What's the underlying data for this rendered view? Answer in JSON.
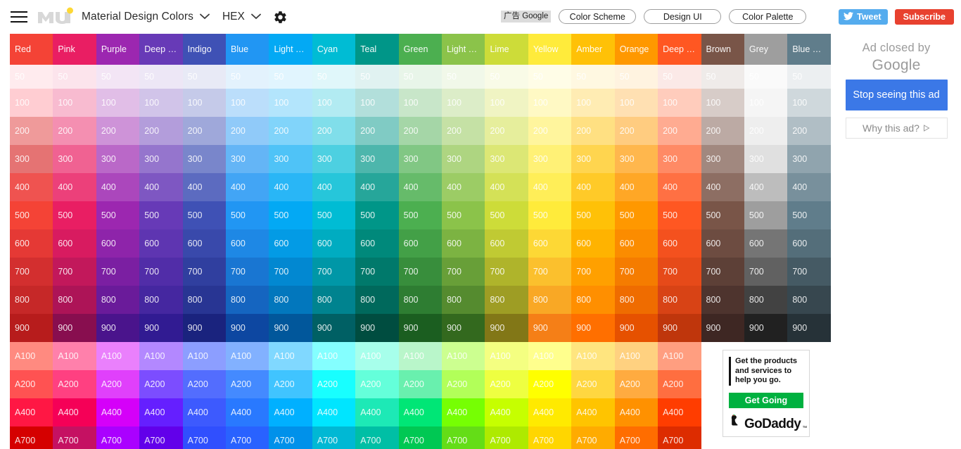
{
  "appbar": {
    "menu_icon": "hamburger-menu-icon",
    "logo": "mui-logo",
    "palette_title": "Material Design Colors",
    "palette_chevron": "chevron-down-icon",
    "format_label": "HEX",
    "format_chevron": "chevron-down-icon",
    "settings_icon": "gear-icon",
    "ad_tag": "广告 Google",
    "ad_chips": [
      "Color Scheme",
      "Design UI",
      "Color Palette"
    ],
    "tweet_label": "Tweet",
    "tweet_icon": "twitter-bird-icon",
    "tweet_color": "#55acee",
    "subscribe_label": "Subscribe",
    "subscribe_color": "#e8412f"
  },
  "ad_panel": {
    "closed_line1": "Ad closed by",
    "closed_line2": "Google",
    "stop_button": "Stop seeing this ad",
    "stop_button_color": "#3b78e7",
    "why_button": "Why this ad?",
    "why_icon": "play-triangle-icon"
  },
  "godaddy_ad": {
    "headline": "Get the products and services to help you go.",
    "cta_label": "Get Going",
    "cta_color": "#00b140",
    "brand": "GoDaddy",
    "brand_mark": "™",
    "logo_icon": "godaddy-heart-icon"
  },
  "palette": {
    "shade_labels": [
      "50",
      "100",
      "200",
      "300",
      "400",
      "500",
      "600",
      "700",
      "800",
      "900",
      "A100",
      "A200",
      "A400",
      "A700"
    ],
    "columns": [
      {
        "name": "Red",
        "label": "Red",
        "shades": {
          "50": "#ffebee",
          "100": "#ffcdd2",
          "200": "#ef9a9a",
          "300": "#e57373",
          "400": "#ef5350",
          "500": "#f44336",
          "600": "#e53935",
          "700": "#d32f2f",
          "800": "#c62828",
          "900": "#b71c1c",
          "A100": "#ff8a80",
          "A200": "#ff5252",
          "A400": "#ff1744",
          "A700": "#d50000"
        }
      },
      {
        "name": "Pink",
        "label": "Pink",
        "shades": {
          "50": "#fce4ec",
          "100": "#f8bbd0",
          "200": "#f48fb1",
          "300": "#f06292",
          "400": "#ec407a",
          "500": "#e91e63",
          "600": "#d81b60",
          "700": "#c2185b",
          "800": "#ad1457",
          "900": "#880e4f",
          "A100": "#ff80ab",
          "A200": "#ff4081",
          "A400": "#f50057",
          "A700": "#c51162"
        }
      },
      {
        "name": "Purple",
        "label": "Purple",
        "shades": {
          "50": "#f3e5f5",
          "100": "#e1bee7",
          "200": "#ce93d8",
          "300": "#ba68c8",
          "400": "#ab47bc",
          "500": "#9c27b0",
          "600": "#8e24aa",
          "700": "#7b1fa2",
          "800": "#6a1b9a",
          "900": "#4a148c",
          "A100": "#ea80fc",
          "A200": "#e040fb",
          "A400": "#d500f9",
          "A700": "#aa00ff"
        }
      },
      {
        "name": "Deep Purple",
        "label": "Deep …",
        "shades": {
          "50": "#ede7f6",
          "100": "#d1c4e9",
          "200": "#b39ddb",
          "300": "#9575cd",
          "400": "#7e57c2",
          "500": "#673ab7",
          "600": "#5e35b1",
          "700": "#512da8",
          "800": "#4527a0",
          "900": "#311b92",
          "A100": "#b388ff",
          "A200": "#7c4dff",
          "A400": "#651fff",
          "A700": "#6200ea"
        }
      },
      {
        "name": "Indigo",
        "label": "Indigo",
        "shades": {
          "50": "#e8eaf6",
          "100": "#c5cae9",
          "200": "#9fa8da",
          "300": "#7986cb",
          "400": "#5c6bc0",
          "500": "#3f51b5",
          "600": "#3949ab",
          "700": "#303f9f",
          "800": "#283593",
          "900": "#1a237e",
          "A100": "#8c9eff",
          "A200": "#536dfe",
          "A400": "#3d5afe",
          "A700": "#304ffe"
        }
      },
      {
        "name": "Blue",
        "label": "Blue",
        "shades": {
          "50": "#e3f2fd",
          "100": "#bbdefb",
          "200": "#90caf9",
          "300": "#64b5f6",
          "400": "#42a5f5",
          "500": "#2196f3",
          "600": "#1e88e5",
          "700": "#1976d2",
          "800": "#1565c0",
          "900": "#0d47a1",
          "A100": "#82b1ff",
          "A200": "#448aff",
          "A400": "#2979ff",
          "A700": "#2962ff"
        }
      },
      {
        "name": "Light Blue",
        "label": "Light …",
        "shades": {
          "50": "#e1f5fe",
          "100": "#b3e5fc",
          "200": "#81d4fa",
          "300": "#4fc3f7",
          "400": "#29b6f6",
          "500": "#03a9f4",
          "600": "#039be5",
          "700": "#0288d1",
          "800": "#0277bd",
          "900": "#01579b",
          "A100": "#80d8ff",
          "A200": "#40c4ff",
          "A400": "#00b0ff",
          "A700": "#0091ea"
        }
      },
      {
        "name": "Cyan",
        "label": "Cyan",
        "shades": {
          "50": "#e0f7fa",
          "100": "#b2ebf2",
          "200": "#80deea",
          "300": "#4dd0e1",
          "400": "#26c6da",
          "500": "#00bcd4",
          "600": "#00acc1",
          "700": "#0097a7",
          "800": "#00838f",
          "900": "#006064",
          "A100": "#84ffff",
          "A200": "#18ffff",
          "A400": "#00e5ff",
          "A700": "#00b8d4"
        }
      },
      {
        "name": "Teal",
        "label": "Teal",
        "shades": {
          "50": "#e0f2f1",
          "100": "#b2dfdb",
          "200": "#80cbc4",
          "300": "#4db6ac",
          "400": "#26a69a",
          "500": "#009688",
          "600": "#00897b",
          "700": "#00796b",
          "800": "#00695c",
          "900": "#004d40",
          "A100": "#a7ffeb",
          "A200": "#64ffda",
          "A400": "#1de9b6",
          "A700": "#00bfa5"
        }
      },
      {
        "name": "Green",
        "label": "Green",
        "shades": {
          "50": "#e8f5e9",
          "100": "#c8e6c9",
          "200": "#a5d6a7",
          "300": "#81c784",
          "400": "#66bb6a",
          "500": "#4caf50",
          "600": "#43a047",
          "700": "#388e3c",
          "800": "#2e7d32",
          "900": "#1b5e20",
          "A100": "#b9f6ca",
          "A200": "#69f0ae",
          "A400": "#00e676",
          "A700": "#00c853"
        }
      },
      {
        "name": "Light Green",
        "label": "Light …",
        "shades": {
          "50": "#f1f8e9",
          "100": "#dcedc8",
          "200": "#c5e1a5",
          "300": "#aed581",
          "400": "#9ccc65",
          "500": "#8bc34a",
          "600": "#7cb342",
          "700": "#689f38",
          "800": "#558b2f",
          "900": "#33691e",
          "A100": "#ccff90",
          "A200": "#b2ff59",
          "A400": "#76ff03",
          "A700": "#64dd17"
        }
      },
      {
        "name": "Lime",
        "label": "Lime",
        "shades": {
          "50": "#f9fbe7",
          "100": "#f0f4c3",
          "200": "#e6ee9c",
          "300": "#dce775",
          "400": "#d4e157",
          "500": "#cddc39",
          "600": "#c0ca33",
          "700": "#afb42b",
          "800": "#9e9d24",
          "900": "#827717",
          "A100": "#f4ff81",
          "A200": "#eeff41",
          "A400": "#c6ff00",
          "A700": "#aeea00"
        }
      },
      {
        "name": "Yellow",
        "label": "Yellow",
        "shades": {
          "50": "#fffde7",
          "100": "#fff9c4",
          "200": "#fff59d",
          "300": "#fff176",
          "400": "#ffee58",
          "500": "#ffeb3b",
          "600": "#fdd835",
          "700": "#fbc02d",
          "800": "#f9a825",
          "900": "#f57f17",
          "A100": "#ffff8d",
          "A200": "#ffff00",
          "A400": "#ffea00",
          "A700": "#ffd600"
        }
      },
      {
        "name": "Amber",
        "label": "Amber",
        "shades": {
          "50": "#fff8e1",
          "100": "#ffecb3",
          "200": "#ffe082",
          "300": "#ffd54f",
          "400": "#ffca28",
          "500": "#ffc107",
          "600": "#ffb300",
          "700": "#ffa000",
          "800": "#ff8f00",
          "900": "#ff6f00",
          "A100": "#ffe57f",
          "A200": "#ffd740",
          "A400": "#ffc400",
          "A700": "#ffab00"
        }
      },
      {
        "name": "Orange",
        "label": "Orange",
        "shades": {
          "50": "#fff3e0",
          "100": "#ffe0b2",
          "200": "#ffcc80",
          "300": "#ffb74d",
          "400": "#ffa726",
          "500": "#ff9800",
          "600": "#fb8c00",
          "700": "#f57c00",
          "800": "#ef6c00",
          "900": "#e65100",
          "A100": "#ffd180",
          "A200": "#ffab40",
          "A400": "#ff9100",
          "A700": "#ff6d00"
        }
      },
      {
        "name": "Deep Orange",
        "label": "Deep …",
        "shades": {
          "50": "#fbe9e7",
          "100": "#ffccbc",
          "200": "#ffab91",
          "300": "#ff8a65",
          "400": "#ff7043",
          "500": "#ff5722",
          "600": "#f4511e",
          "700": "#e64a19",
          "800": "#d84315",
          "900": "#bf360c",
          "A100": "#ff9e80",
          "A200": "#ff6e40",
          "A400": "#ff3d00",
          "A700": "#dd2c00"
        }
      },
      {
        "name": "Brown",
        "label": "Brown",
        "shades": {
          "50": "#efebe9",
          "100": "#d7ccc8",
          "200": "#bcaaa4",
          "300": "#a1887f",
          "400": "#8d6e63",
          "500": "#795548",
          "600": "#6d4c41",
          "700": "#5d4037",
          "800": "#4e342e",
          "900": "#3e2723",
          "A100": "",
          "A200": "",
          "A400": "",
          "A700": ""
        }
      },
      {
        "name": "Grey",
        "label": "Grey",
        "shades": {
          "50": "#fafafa",
          "100": "#f5f5f5",
          "200": "#eeeeee",
          "300": "#e0e0e0",
          "400": "#bdbdbd",
          "500": "#9e9e9e",
          "600": "#757575",
          "700": "#616161",
          "800": "#424242",
          "900": "#212121",
          "A100": "",
          "A200": "",
          "A400": "",
          "A700": ""
        }
      },
      {
        "name": "Blue Grey",
        "label": "Blue …",
        "shades": {
          "50": "#eceff1",
          "100": "#cfd8dc",
          "200": "#b0bec5",
          "300": "#90a4ae",
          "400": "#78909c",
          "500": "#607d8b",
          "600": "#546e7a",
          "700": "#455a64",
          "800": "#37474f",
          "900": "#263238",
          "A100": "",
          "A200": "",
          "A400": "",
          "A700": ""
        }
      }
    ]
  }
}
